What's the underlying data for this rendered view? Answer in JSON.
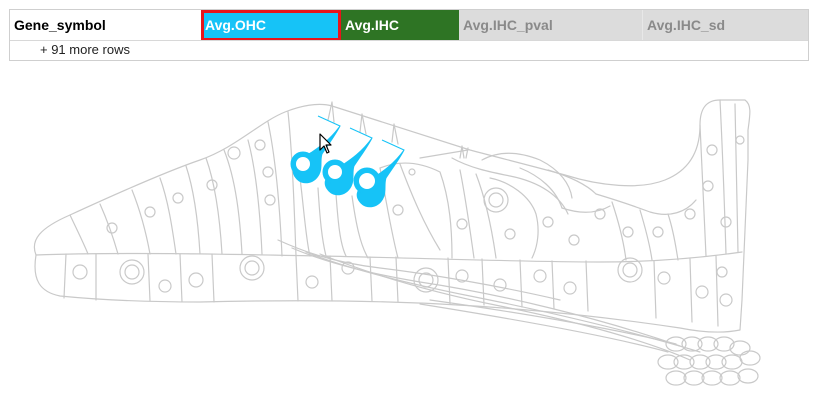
{
  "table": {
    "columns": [
      {
        "label": "Gene_symbol",
        "bg": "#ffffff",
        "color": "#000000"
      },
      {
        "label": "Avg.OHC",
        "bg": "#16c3f7",
        "color": "#ffffff",
        "selected": true,
        "selection_color": "#e8141b"
      },
      {
        "label": "Avg.IHC",
        "bg": "#2e7424",
        "color": "#ffffff"
      },
      {
        "label": "Avg.IHC_pval",
        "bg": "#dcdcdc",
        "color": "#8a8a8a"
      },
      {
        "label": "Avg.IHC_sd",
        "bg": "#dcdcdc",
        "color": "#8a8a8a"
      }
    ],
    "more_rows": "+ 91 more rows"
  },
  "diagram": {
    "outline_color": "#c9c9c9",
    "highlight_color": "#16c3f7",
    "highlighted_cells": "outer-hair-cells"
  }
}
